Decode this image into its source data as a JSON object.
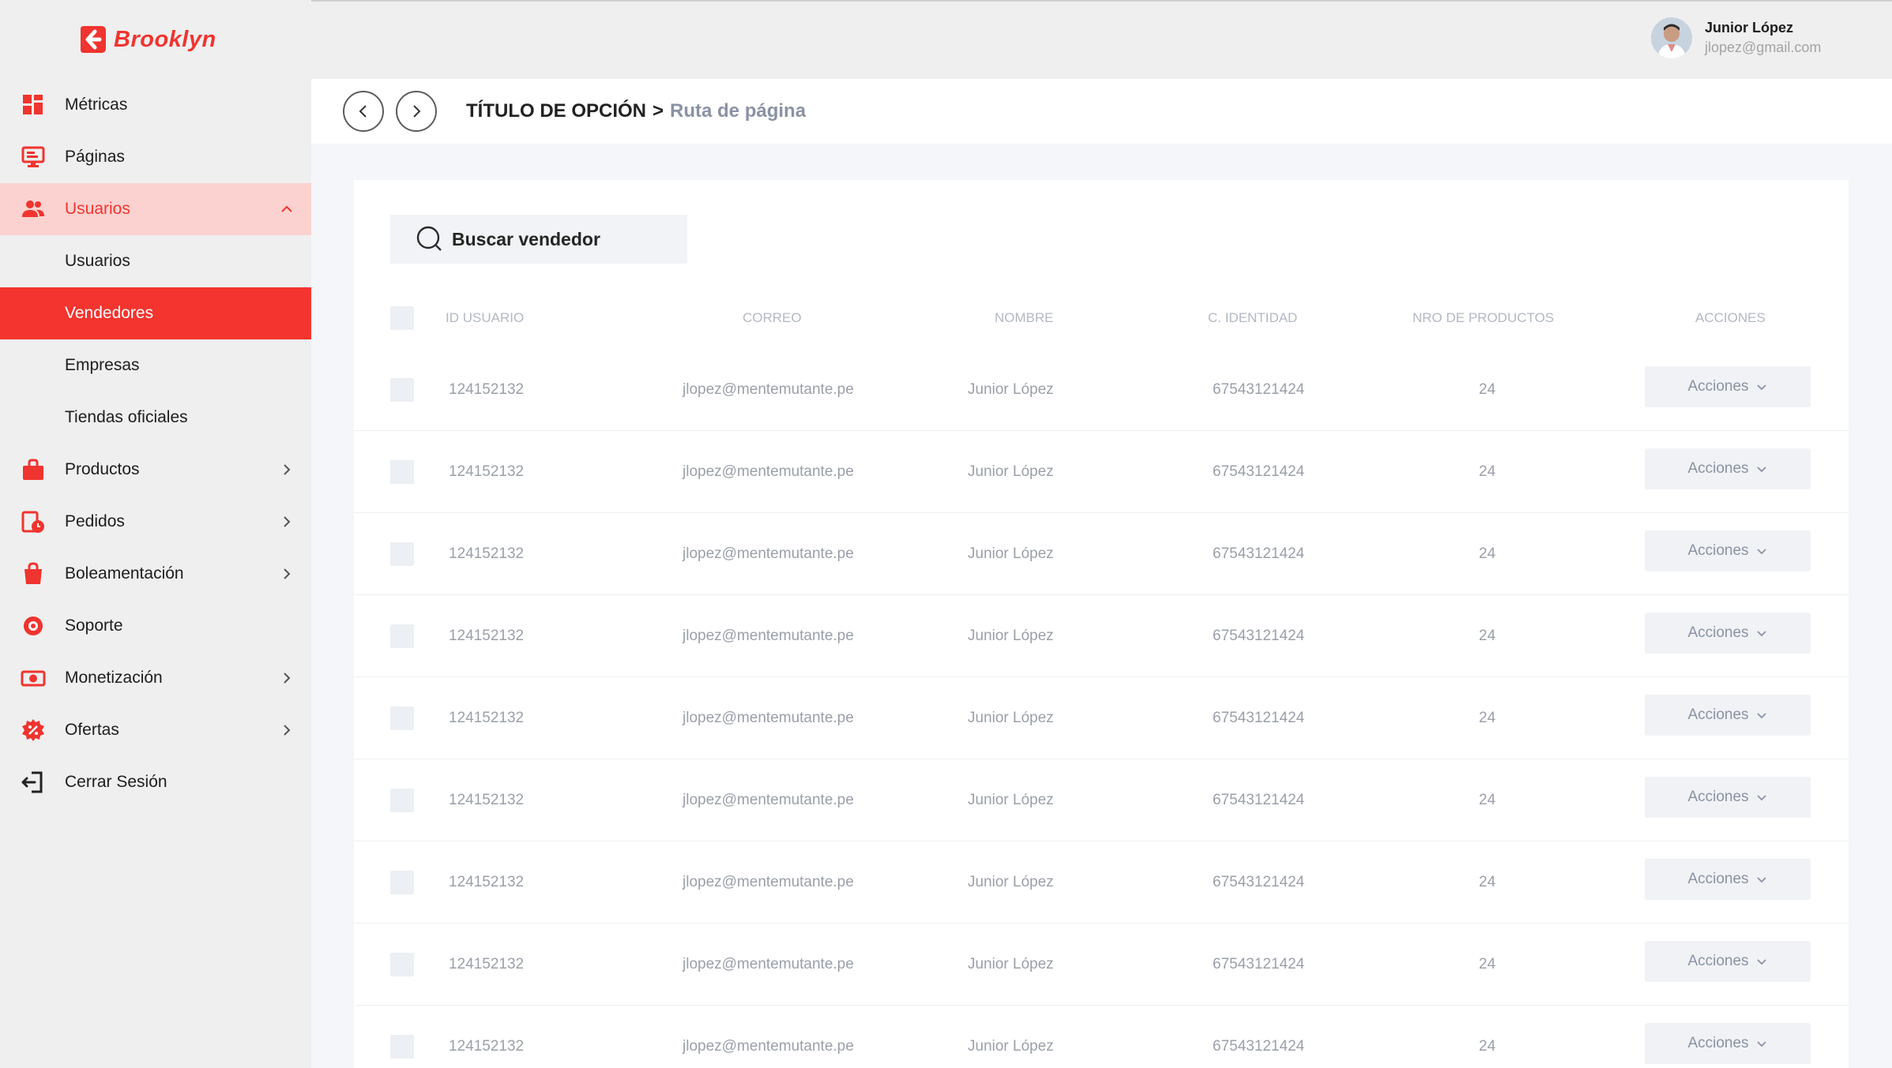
{
  "brand": {
    "name": "Brooklyn",
    "accent": "#f0342f"
  },
  "user": {
    "name": "Junior López",
    "email": "jlopez@gmail.com"
  },
  "sidebar": {
    "items": [
      {
        "label": "Métricas",
        "icon": "dashboard-icon"
      },
      {
        "label": "Páginas",
        "icon": "monitor-icon"
      },
      {
        "label": "Usuarios",
        "icon": "users-icon",
        "expanded": true
      },
      {
        "label": "Usuarios",
        "sub": true
      },
      {
        "label": "Vendedores",
        "sub": true,
        "active": true
      },
      {
        "label": "Empresas",
        "sub": true
      },
      {
        "label": "Tiendas oficiales",
        "sub": true
      },
      {
        "label": "Productos",
        "icon": "bag-icon"
      },
      {
        "label": "Pedidos",
        "icon": "orders-icon"
      },
      {
        "label": "Boleamentación",
        "icon": "shopping-bag-icon"
      },
      {
        "label": "Soporte",
        "icon": "support-icon"
      },
      {
        "label": "Monetización",
        "icon": "money-icon"
      },
      {
        "label": "Ofertas",
        "icon": "offer-icon"
      },
      {
        "label": "Cerrar Sesión",
        "icon": "logout-icon"
      }
    ]
  },
  "breadcrumb": {
    "title": "TÍTULO DE OPCIÓN",
    "separator": ">",
    "path": "Ruta de página"
  },
  "search": {
    "placeholder": "Buscar vendedor"
  },
  "table": {
    "headers": [
      "ID USUARIO",
      "CORREO",
      "NOMBRE",
      "C. IDENTIDAD",
      "NRO DE PRODUCTOS",
      "ACCIONES"
    ],
    "rows": [
      {
        "id": "124152132",
        "email": "jlopez@mentemutante.pe",
        "name": "Junior López",
        "ci": "67543121424",
        "products": "24",
        "action": "Acciones"
      },
      {
        "id": "124152132",
        "email": "jlopez@mentemutante.pe",
        "name": "Junior López",
        "ci": "67543121424",
        "products": "24",
        "action": "Acciones"
      },
      {
        "id": "124152132",
        "email": "jlopez@mentemutante.pe",
        "name": "Junior López",
        "ci": "67543121424",
        "products": "24",
        "action": "Acciones"
      },
      {
        "id": "124152132",
        "email": "jlopez@mentemutante.pe",
        "name": "Junior López",
        "ci": "67543121424",
        "products": "24",
        "action": "Acciones"
      },
      {
        "id": "124152132",
        "email": "jlopez@mentemutante.pe",
        "name": "Junior López",
        "ci": "67543121424",
        "products": "24",
        "action": "Acciones"
      },
      {
        "id": "124152132",
        "email": "jlopez@mentemutante.pe",
        "name": "Junior López",
        "ci": "67543121424",
        "products": "24",
        "action": "Acciones"
      },
      {
        "id": "124152132",
        "email": "jlopez@mentemutante.pe",
        "name": "Junior López",
        "ci": "67543121424",
        "products": "24",
        "action": "Acciones"
      },
      {
        "id": "124152132",
        "email": "jlopez@mentemutante.pe",
        "name": "Junior López",
        "ci": "67543121424",
        "products": "24",
        "action": "Acciones"
      },
      {
        "id": "124152132",
        "email": "jlopez@mentemutante.pe",
        "name": "Junior López",
        "ci": "67543121424",
        "products": "24",
        "action": "Acciones"
      }
    ]
  }
}
